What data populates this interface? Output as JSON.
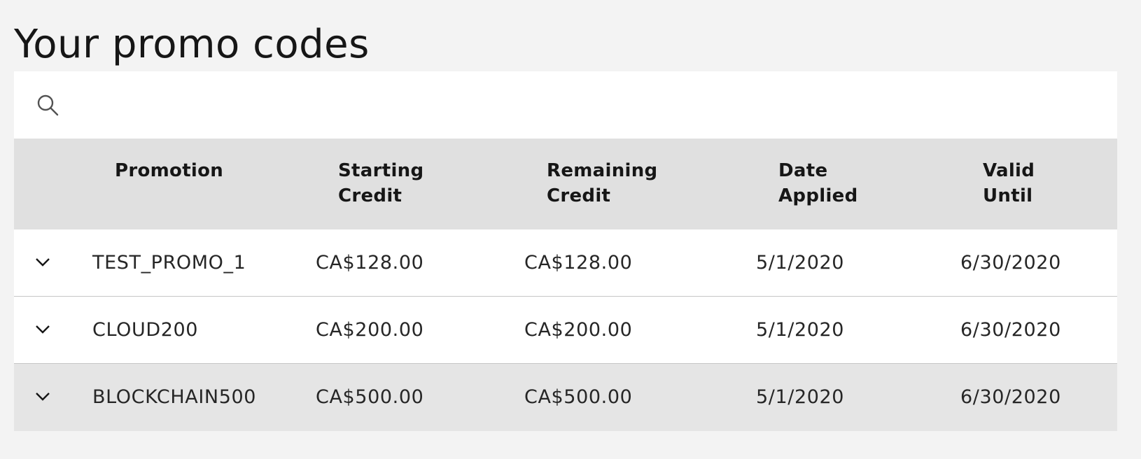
{
  "page": {
    "title": "Your promo codes"
  },
  "search": {
    "value": "",
    "icon": "search-icon"
  },
  "table": {
    "headers": [
      {
        "line1": "Promotion",
        "line2": ""
      },
      {
        "line1": "Starting",
        "line2": "Credit"
      },
      {
        "line1": "Remaining",
        "line2": "Credit"
      },
      {
        "line1": "Date",
        "line2": "Applied"
      },
      {
        "line1": "Valid",
        "line2": "Until"
      }
    ],
    "rows": [
      {
        "promotion": "TEST_PROMO_1",
        "starting_credit": "CA$128.00",
        "remaining_credit": "CA$128.00",
        "date_applied": "5/1/2020",
        "valid_until": "6/30/2020"
      },
      {
        "promotion": "CLOUD200",
        "starting_credit": "CA$200.00",
        "remaining_credit": "CA$200.00",
        "date_applied": "5/1/2020",
        "valid_until": "6/30/2020"
      },
      {
        "promotion": "BLOCKCHAIN500",
        "starting_credit": "CA$500.00",
        "remaining_credit": "CA$500.00",
        "date_applied": "5/1/2020",
        "valid_until": "6/30/2020"
      }
    ],
    "expand_icon": "chevron-down-icon"
  },
  "colors": {
    "page_background": "#f3f3f3",
    "header_background": "#e0e0e0",
    "row_background": "#ffffff",
    "row_hover_background": "#e5e5e5",
    "text": "#161616"
  }
}
